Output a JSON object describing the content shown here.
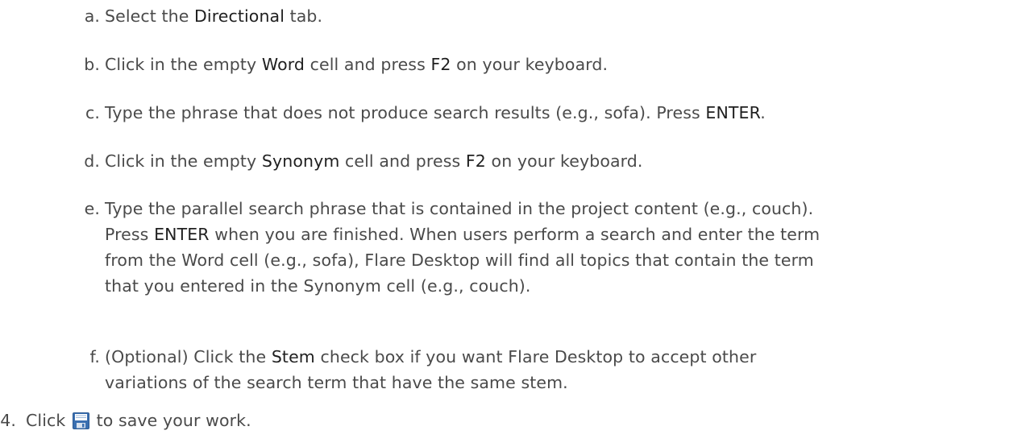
{
  "steps": {
    "a": {
      "marker": "a.",
      "t1": "Select the ",
      "b1": "Directional",
      "t2": " tab."
    },
    "b": {
      "marker": "b.",
      "t1": "Click in the empty ",
      "b1": "Word",
      "t2": " cell and press ",
      "b2": "F2",
      "t3": " on your keyboard."
    },
    "c": {
      "marker": "c.",
      "t1": "Type the phrase that does not produce search results (e.g., sofa). Press ",
      "b1": "ENTER",
      "t2": "."
    },
    "d": {
      "marker": "d.",
      "t1": "Click in the empty ",
      "b1": "Synonym",
      "t2": " cell and press ",
      "b2": "F2",
      "t3": " on your keyboard."
    },
    "e": {
      "marker": "e.",
      "line1": "Type the parallel search phrase that is contained in the project content (e.g., couch).",
      "t1": "Press ",
      "b1": "ENTER",
      "t2": " when you are finished. When users perform a search and enter the term",
      "line3": "from the Word cell (e.g., sofa), Flare Desktop will find all topics that contain the term",
      "line4": "that you entered in the Synonym cell (e.g., couch)."
    },
    "f": {
      "marker": "f.",
      "t1": "(Optional) Click the ",
      "b1": "Stem",
      "t2": " check box if you want Flare Desktop to accept other",
      "line2": "variations of the search term that have the same stem."
    }
  },
  "step4": {
    "marker": "4.",
    "t1": "Click ",
    "t2": " to save your work."
  },
  "icon": {
    "save_icon": "save-icon (floppy disk)",
    "save_color": "#3a6fb0"
  }
}
